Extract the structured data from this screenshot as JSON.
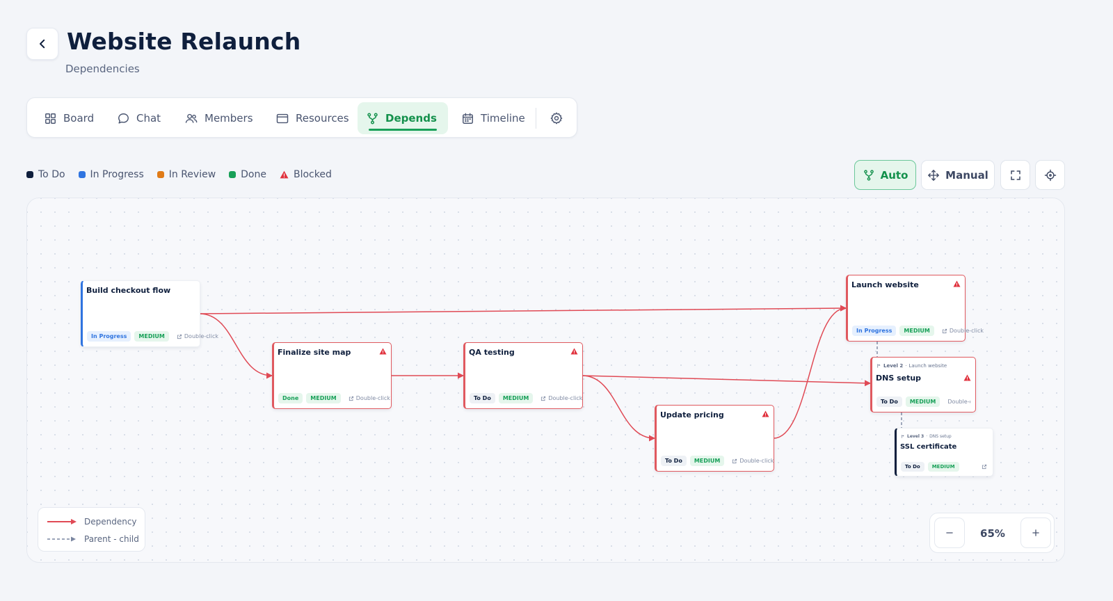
{
  "header": {
    "title": "Website Relaunch",
    "subtitle": "Dependencies",
    "back_icon": "chevron-left-icon"
  },
  "tabs": [
    {
      "label": "Board",
      "icon": "grid-icon",
      "active": false
    },
    {
      "label": "Chat",
      "icon": "chat-bubble-icon",
      "active": false
    },
    {
      "label": "Members",
      "icon": "users-icon",
      "active": false
    },
    {
      "label": "Resources",
      "icon": "folder-icon",
      "active": false
    },
    {
      "label": "Depends",
      "icon": "branch-icon",
      "active": true
    },
    {
      "label": "Timeline",
      "icon": "calendar-icon",
      "active": false
    }
  ],
  "status_legend": [
    {
      "label": "To Do",
      "color": "#0f1f3d"
    },
    {
      "label": "In Progress",
      "color": "#2f74e0"
    },
    {
      "label": "In Review",
      "color": "#e07b17"
    },
    {
      "label": "Done",
      "color": "#18a058"
    },
    {
      "label": "Blocked",
      "color": "#e0323e"
    }
  ],
  "layout_controls": {
    "auto": "Auto",
    "manual": "Manual",
    "active": "auto"
  },
  "nodes": {
    "build_checkout": {
      "title": "Build checkout flow",
      "status": "In Progress",
      "priority": "MEDIUM",
      "link": "Double-click",
      "blocked": false
    },
    "finalize_site_map": {
      "title": "Finalize site map",
      "status": "Done",
      "priority": "MEDIUM",
      "link": "Double-click",
      "blocked": true
    },
    "qa_testing": {
      "title": "QA testing",
      "status": "To Do",
      "priority": "MEDIUM",
      "link": "Double-click",
      "blocked": true
    },
    "update_pricing": {
      "title": "Update pricing",
      "status": "To Do",
      "priority": "MEDIUM",
      "link": "Double-click",
      "blocked": true
    },
    "launch_website": {
      "title": "Launch website",
      "status": "In Progress",
      "priority": "MEDIUM",
      "link": "Double-click",
      "blocked": true
    },
    "dns_setup": {
      "title": "DNS setup",
      "level": "Level 2",
      "parent": "Launch website",
      "status": "To Do",
      "priority": "MEDIUM",
      "link": "Double-click",
      "blocked": true
    },
    "ssl_certificate": {
      "title": "SSL certificate",
      "level": "Level 3",
      "parent": "DNS setup",
      "status": "To Do",
      "priority": "MEDIUM",
      "blocked": false
    }
  },
  "connection_legend": {
    "dependency": "Dependency",
    "parent_child": "Parent - child"
  },
  "zoom": {
    "value": "65%",
    "minus_icon": "minus-icon",
    "plus_icon": "plus-icon"
  },
  "colors": {
    "accent": "#18a058",
    "blocked": "#e0323e",
    "dependency_edge": "#e04a55",
    "parent_edge": "#7a86a0"
  }
}
